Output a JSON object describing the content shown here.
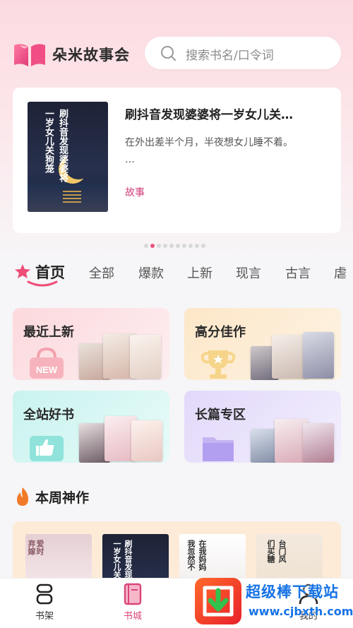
{
  "app": {
    "name": "朵米故事会",
    "logo_icon": "book-logo-icon"
  },
  "search": {
    "placeholder": "搜索书名/口令词",
    "icon": "search-icon"
  },
  "banner": {
    "cover_title": "刷抖音发现婆婆将一岁女儿关狗笼",
    "cover_col1": "刷抖音发现婆婆将",
    "cover_col2": "一岁女儿关狗笼",
    "title": "刷抖音发现婆婆将一岁女儿关…",
    "description_line1": "在外出差半个月，半夜想女儿睡不着。",
    "description_line2": "…",
    "tag": "故事",
    "page_count": 10,
    "active_page": 1
  },
  "tabs": [
    "首页",
    "全部",
    "爆款",
    "上新",
    "现言",
    "古言",
    "虐"
  ],
  "active_tab": 0,
  "categories": [
    {
      "title": "最近上新",
      "icon": "new-bag-icon",
      "badge": "NEW",
      "color": "#fce1e3"
    },
    {
      "title": "高分佳作",
      "icon": "trophy-icon",
      "color": "#fdf0d9"
    },
    {
      "title": "全站好书",
      "icon": "thumbs-up-icon",
      "color": "#d6f6f2"
    },
    {
      "title": "长篇专区",
      "icon": "folder-icon",
      "color": "#ebe4fb"
    }
  ],
  "weekly": {
    "title": "本周神作",
    "books": [
      {
        "col1": "爱时",
        "col2": "弃嫁"
      },
      {
        "col1": "刷抖音发现",
        "col2": "一岁女儿关"
      },
      {
        "col1": "在我妈妈",
        "col2": "我忽然不"
      },
      {
        "col1": "台门风",
        "col2": "们买糖"
      }
    ]
  },
  "tabbar": [
    {
      "label": "书架",
      "icon": "bookshelf-icon"
    },
    {
      "label": "书城",
      "icon": "bookstore-icon"
    },
    {
      "label": "我的",
      "icon": "profile-icon"
    }
  ],
  "active_tabbar": 1,
  "watermark": {
    "text": "超级棒下载站",
    "url": "www.cjbxth.com"
  },
  "colors": {
    "accent": "#e9567e",
    "tag": "#d0407c",
    "watermark": "#1673e6"
  }
}
